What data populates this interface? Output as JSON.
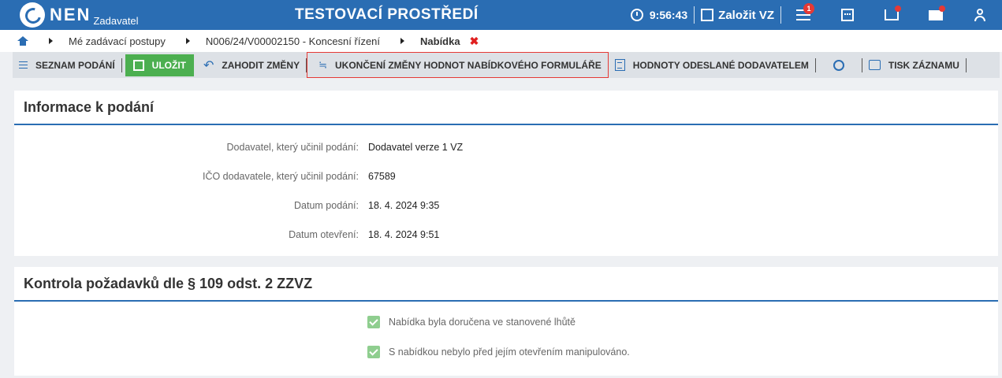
{
  "header": {
    "logo_text": "NEN",
    "logo_sub": "Zadavatel",
    "environment": "TESTOVACÍ PROSTŘEDÍ",
    "time": "9:56:43",
    "new_vz_label": "Založit VZ",
    "notification_count": "1"
  },
  "breadcrumb": {
    "items": [
      "Mé zadávací postupy",
      "N006/24/V00002150 - Koncesní řízení",
      "Nabídka"
    ],
    "close_symbol": "✖"
  },
  "toolbar": {
    "list_label": "SEZNAM PODÁNÍ",
    "save_label": "ULOŽIT",
    "discard_label": "ZAHODIT ZMĚNY",
    "end_changes_label": "UKONČENÍ ZMĚNY HODNOT NABÍDKOVÉHO FORMULÁŘE",
    "sent_values_label": "HODNOTY ODESLANÉ DODAVATELEM",
    "print_label": "TISK ZÁZNAMU"
  },
  "info_panel": {
    "title": "Informace k podání",
    "rows": [
      {
        "label": "Dodavatel, který učinil podání:",
        "value": "Dodavatel verze 1 VZ"
      },
      {
        "label": "IČO dodavatele, který učinil podání:",
        "value": "67589"
      },
      {
        "label": "Datum podání:",
        "value": "18. 4. 2024 9:35"
      },
      {
        "label": "Datum otevření:",
        "value": "18. 4. 2024 9:51"
      }
    ]
  },
  "control_panel": {
    "title": "Kontrola požadavků dle § 109 odst. 2 ZZVZ",
    "checks": [
      {
        "label": "Nabídka byla doručena ve stanovené lhůtě",
        "checked": true
      },
      {
        "label": "S nabídkou nebylo před jejím otevřením manipulováno.",
        "checked": true
      }
    ]
  },
  "colors": {
    "header_bg": "#2a6db3",
    "save_bg": "#4caf50",
    "highlight_border": "#e53935",
    "check_bg": "#8fce8f"
  }
}
